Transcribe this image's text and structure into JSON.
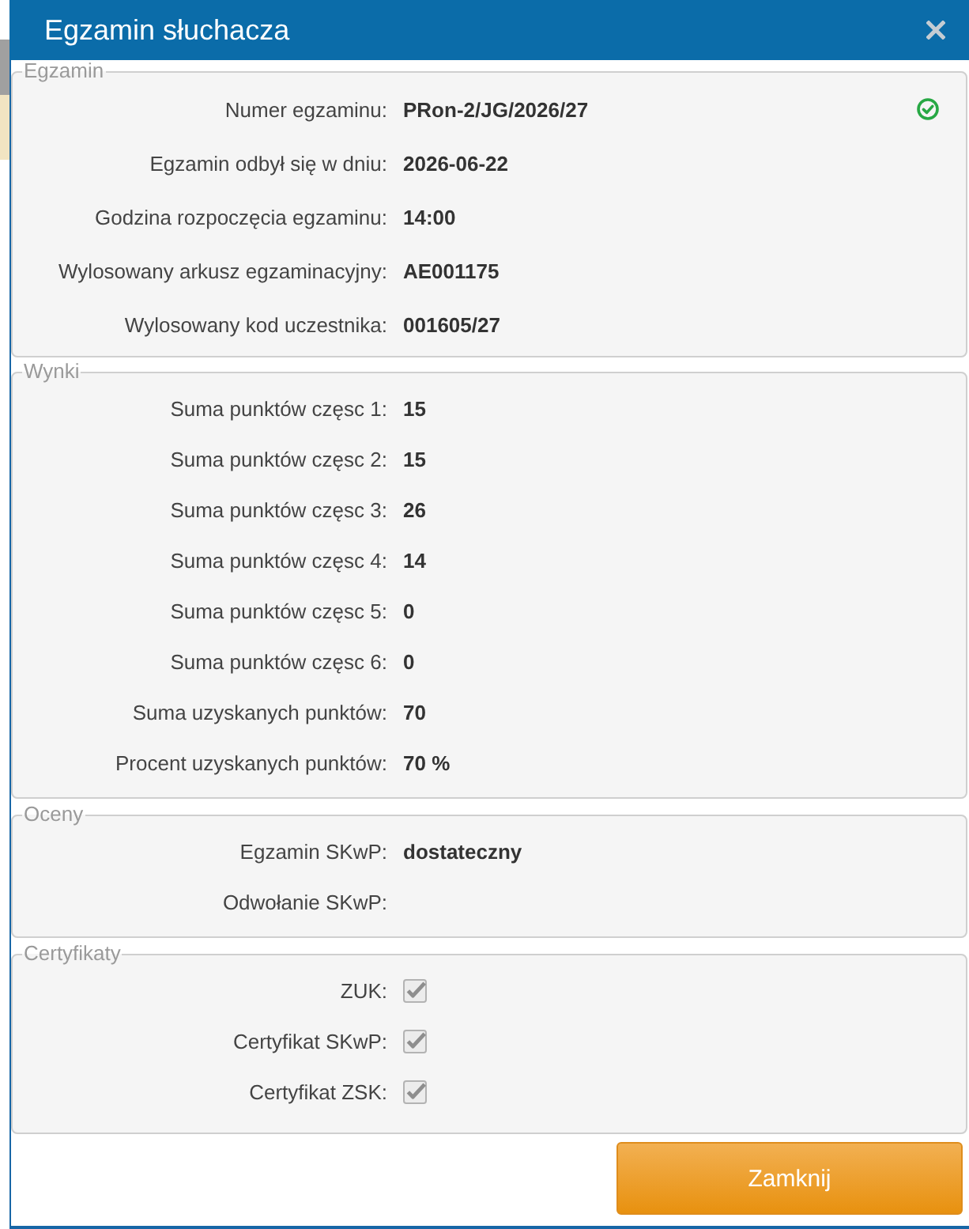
{
  "dialog": {
    "title": "Egzamin słuchacza"
  },
  "sections": [
    {
      "legend": "Egzamin",
      "rows": [
        {
          "kind": "text",
          "label": "Numer egzaminu:",
          "value": "PRon-2/JG/2026/27",
          "verified": true
        },
        {
          "kind": "text",
          "label": "Egzamin odbył się w dniu:",
          "value": "2026-06-22",
          "verified": false
        },
        {
          "kind": "text",
          "label": "Godzina rozpoczęcia egzaminu:",
          "value": "14:00",
          "verified": false
        },
        {
          "kind": "text",
          "label": "Wylosowany arkusz egzaminacyjny:",
          "value": "AE001175",
          "verified": false
        },
        {
          "kind": "text",
          "label": "Wylosowany kod uczestnika:",
          "value": "001605/27",
          "verified": false
        }
      ]
    },
    {
      "legend": "Wynki",
      "rows": [
        {
          "kind": "text",
          "label": "Suma punktów częsc 1:",
          "value": "15"
        },
        {
          "kind": "text",
          "label": "Suma punktów częsc 2:",
          "value": "15"
        },
        {
          "kind": "text",
          "label": "Suma punktów częsc 3:",
          "value": "26"
        },
        {
          "kind": "text",
          "label": "Suma punktów częsc 4:",
          "value": "14"
        },
        {
          "kind": "text",
          "label": "Suma punktów częsc 5:",
          "value": "0"
        },
        {
          "kind": "text",
          "label": "Suma punktów częsc 6:",
          "value": "0"
        },
        {
          "kind": "text",
          "label": "Suma uzyskanych punktów:",
          "value": "70"
        },
        {
          "kind": "text",
          "label": "Procent uzyskanych punktów:",
          "value": "70 %"
        }
      ]
    },
    {
      "legend": "Oceny",
      "rows": [
        {
          "kind": "text",
          "label": "Egzamin SKwP:",
          "value": "dostateczny"
        },
        {
          "kind": "text",
          "label": "Odwołanie SKwP:"
        }
      ]
    },
    {
      "legend": "Certyfikaty",
      "rows": [
        {
          "kind": "checkbox",
          "label": "ZUK:",
          "checked": true,
          "disabled": true
        },
        {
          "kind": "checkbox",
          "label": "Certyfikat SKwP:",
          "checked": true,
          "disabled": true
        },
        {
          "kind": "checkbox",
          "label": "Certyfikat ZSK:",
          "checked": true,
          "disabled": true
        }
      ]
    }
  ],
  "buttons": [
    {
      "label": "Zamknij"
    }
  ]
}
